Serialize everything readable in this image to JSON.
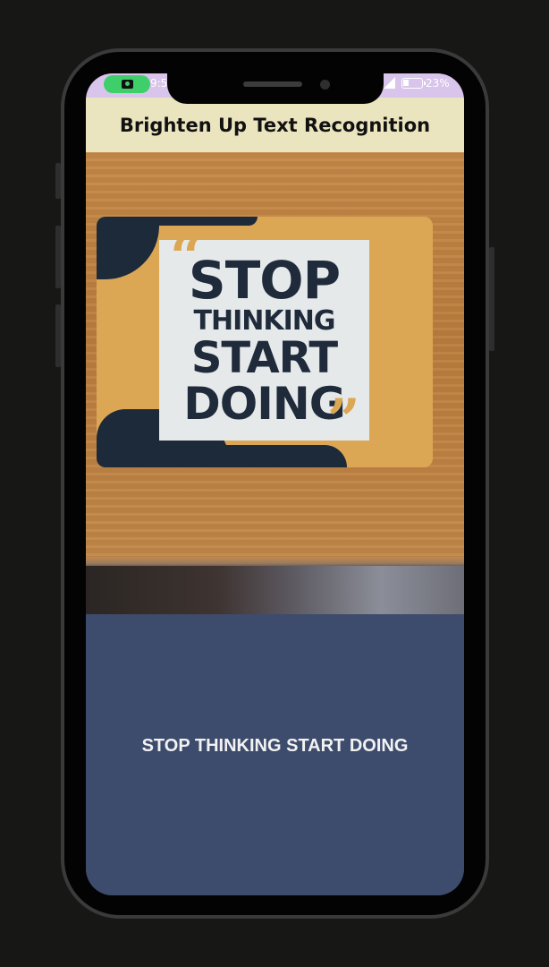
{
  "status_bar": {
    "time": "9:5",
    "battery_text": "23%",
    "pill_color": "#3fcf6a",
    "icons": [
      "camera-icon",
      "signal-icon",
      "battery-icon"
    ]
  },
  "app_bar": {
    "title": "Brighten Up Text Recognition"
  },
  "image": {
    "poster_lines": [
      "STOP",
      "THINKING",
      "START",
      "DOING"
    ],
    "quote_open": "“",
    "quote_close": "”"
  },
  "result": {
    "recognized_text": "STOP THINKING START DOING"
  },
  "colors": {
    "app_bar_bg": "#ebe5bf",
    "result_bg": "#3d4b6c",
    "status_bar_bg": "#d9c4ec"
  }
}
